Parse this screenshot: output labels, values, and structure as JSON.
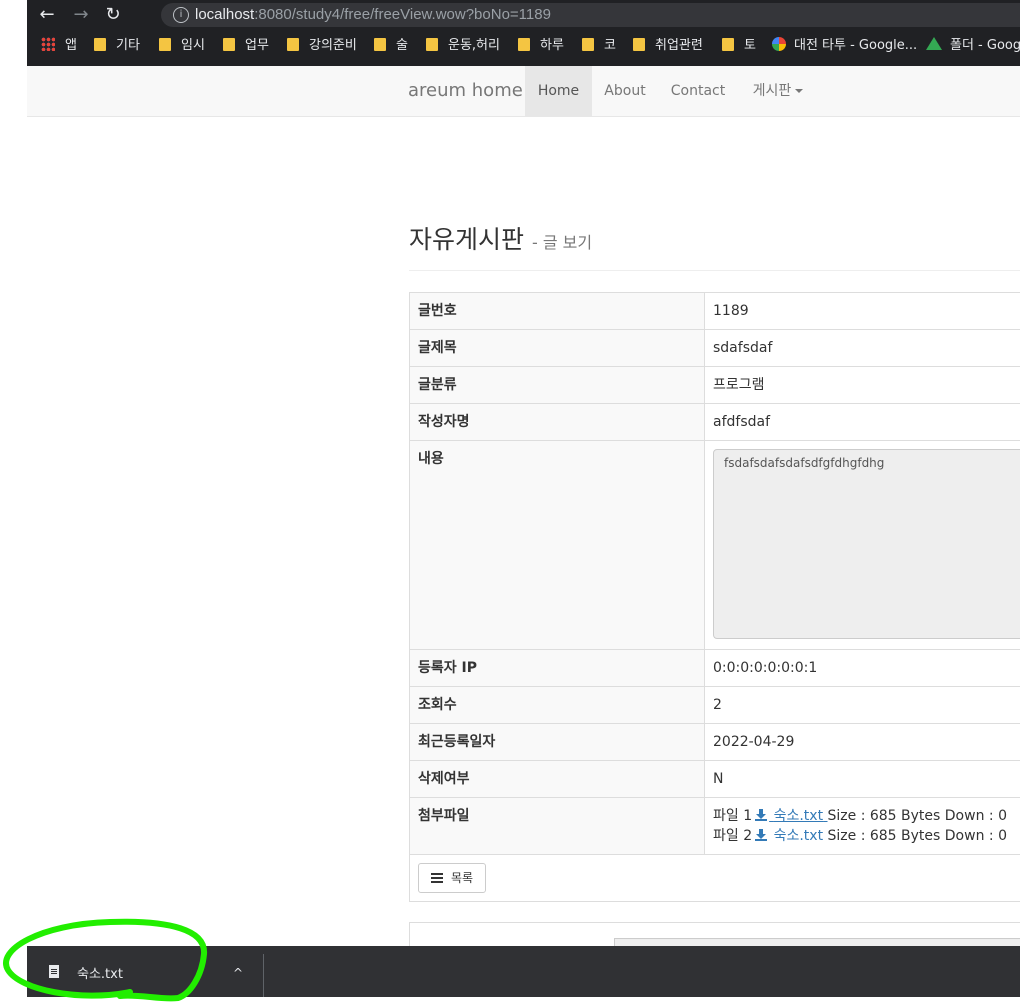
{
  "browser": {
    "url_host": "localhost",
    "url_rest": ":8080/study4/free/freeView.wow?boNo=1189",
    "info_symbol": "i",
    "back_symbol": "←",
    "forward_symbol": "→",
    "reload_symbol": "↻"
  },
  "bookmarks": [
    {
      "label": "앱",
      "icon": "apps-icon"
    },
    {
      "label": "기타",
      "icon": "folder-icon"
    },
    {
      "label": "임시",
      "icon": "folder-icon"
    },
    {
      "label": "업무",
      "icon": "folder-icon"
    },
    {
      "label": "강의준비",
      "icon": "folder-icon"
    },
    {
      "label": "술",
      "icon": "folder-icon"
    },
    {
      "label": "운동,허리",
      "icon": "folder-icon"
    },
    {
      "label": "하루",
      "icon": "folder-icon"
    },
    {
      "label": "코",
      "icon": "folder-icon"
    },
    {
      "label": "취업관련",
      "icon": "folder-icon"
    },
    {
      "label": "토",
      "icon": "folder-icon"
    },
    {
      "label": "대전 타투 - Google...",
      "icon": "google-icon"
    },
    {
      "label": "폴더 - Googl",
      "icon": "drive-icon"
    }
  ],
  "navbar": {
    "brand": "areum home",
    "links": [
      "Home",
      "About",
      "Contact",
      "게시판"
    ]
  },
  "page": {
    "title": "자유게시판",
    "separator": "-",
    "subtitle": "글 보기"
  },
  "detail": {
    "rows": [
      {
        "label": "글번호",
        "value": "1189"
      },
      {
        "label": "글제목",
        "value": "sdafsdaf"
      },
      {
        "label": "글분류",
        "value": "프로그램"
      },
      {
        "label": "작성자명",
        "value": "afdfsdaf"
      },
      {
        "label": "내용",
        "value": "fsdafsdafsdafsdfgfdhgfdhg"
      },
      {
        "label": "등록자 IP",
        "value": "0:0:0:0:0:0:0:1"
      },
      {
        "label": "조회수",
        "value": "2"
      },
      {
        "label": "최근등록일자",
        "value": "2022-04-29"
      },
      {
        "label": "삭제여부",
        "value": "N"
      },
      {
        "label": "첨부파일",
        "value": ""
      }
    ],
    "files": [
      {
        "prefix": "파일 1",
        "name": "숙소.txt",
        "meta": "Size : 685 Bytes Down : 0"
      },
      {
        "prefix": "파일 2",
        "name": "숙소.txt",
        "meta": "Size : 685 Bytes Down : 0"
      }
    ],
    "list_button": "목록"
  },
  "download_bar": {
    "file_name": "숙소.txt",
    "chevron": "^"
  },
  "colors": {
    "link": "#337ab7",
    "highlight": "#22ee00",
    "chrome_dark": "#202124"
  }
}
